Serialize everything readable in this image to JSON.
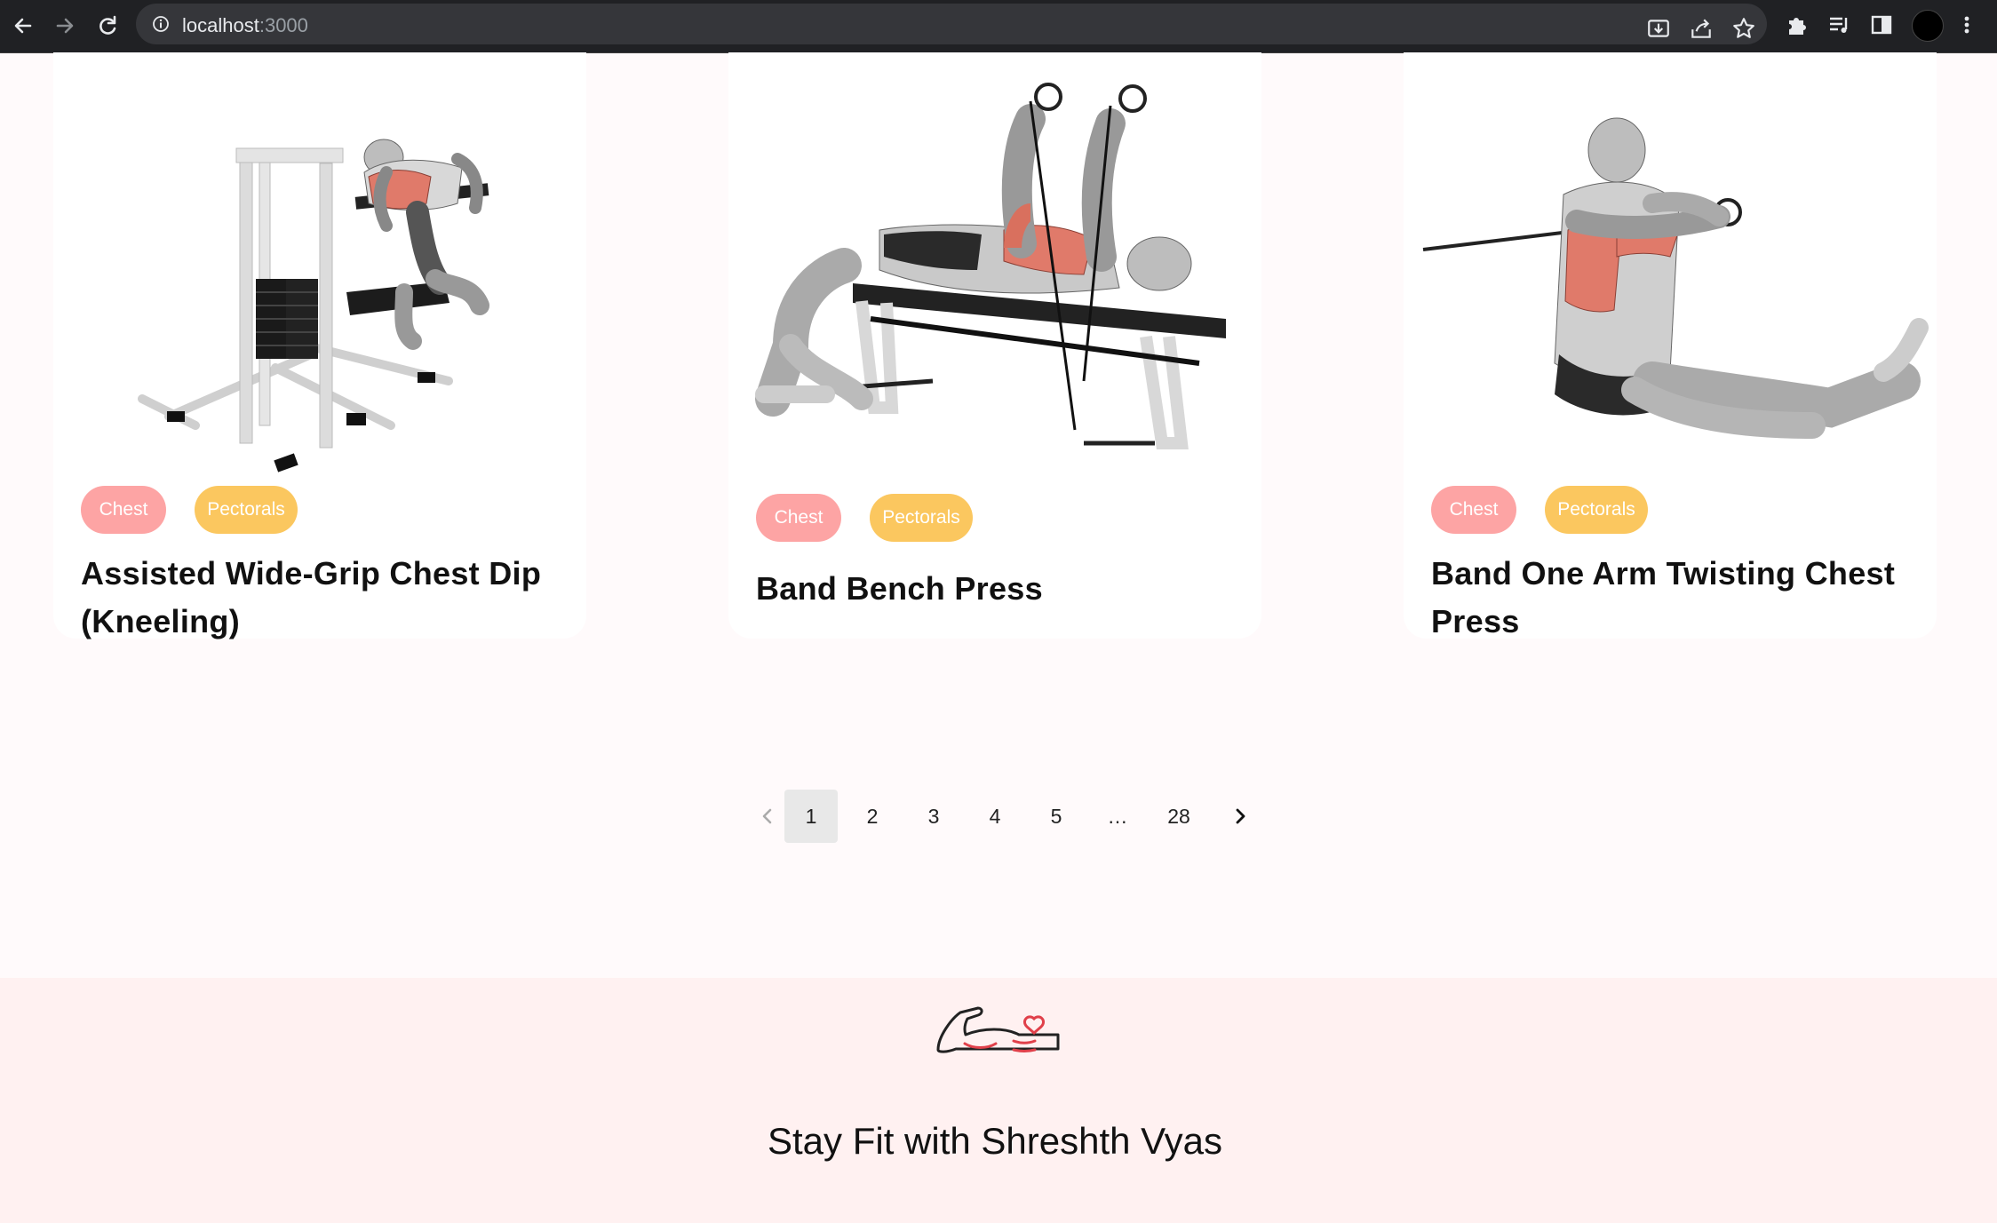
{
  "browser": {
    "url_host": "localhost",
    "url_port": ":3000"
  },
  "exercises": [
    {
      "name": "Assisted Wide-Grip Chest Dip (Kneeling)",
      "tags": [
        "Chest",
        "Pectorals"
      ],
      "illustration": "assisted-dip-machine-illustration"
    },
    {
      "name": "Band Bench Press",
      "tags": [
        "Chest",
        "Pectorals"
      ],
      "illustration": "band-bench-press-illustration"
    },
    {
      "name": "Band One Arm Twisting Chest Press",
      "tags": [
        "Chest",
        "Pectorals"
      ],
      "illustration": "band-twisting-press-illustration"
    }
  ],
  "pagination": {
    "pages": [
      "1",
      "2",
      "3",
      "4",
      "5",
      "…",
      "28"
    ],
    "current": "1",
    "prev_icon": "chevron-left-icon",
    "next_icon": "chevron-right-icon"
  },
  "footer": {
    "logo_icon": "flexed-arm-heart-icon",
    "tagline": "Stay Fit with Shreshth Vyas"
  },
  "colors": {
    "chest_tag": "#fda4a4",
    "pectorals_tag": "#fbc75f",
    "footer_bg": "#fff1f1",
    "page_bg": "#fffafb"
  }
}
